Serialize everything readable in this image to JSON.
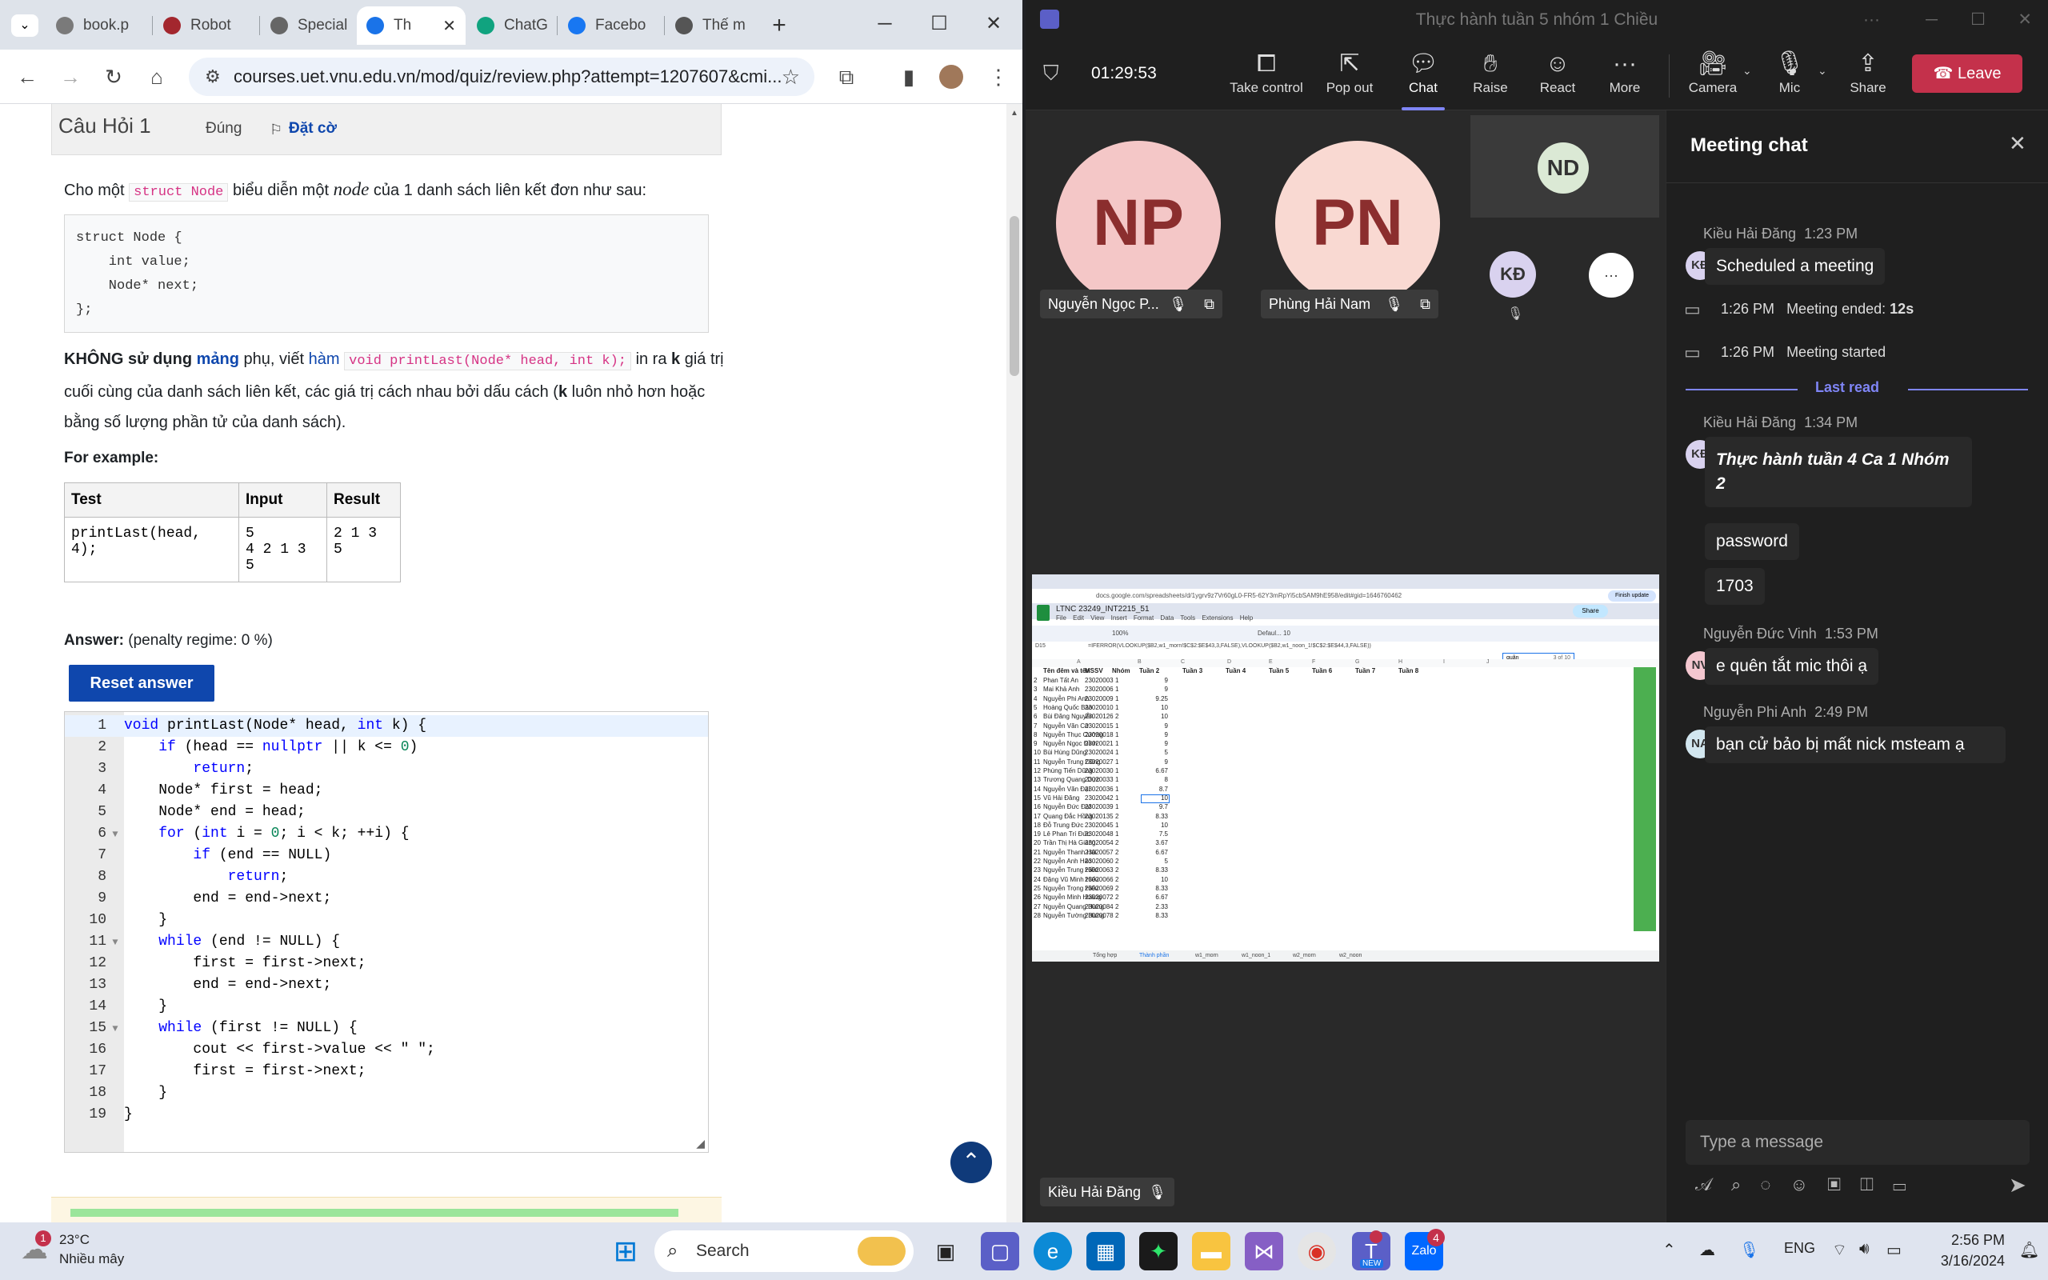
{
  "chrome": {
    "tabs": [
      {
        "label": "book.p",
        "color": "#7a7a7a"
      },
      {
        "label": "Robot",
        "color": "#a3272e"
      },
      {
        "label": "Special",
        "color": "#666"
      },
      {
        "label": "Th",
        "color": "#1a73e8"
      },
      {
        "label": "ChatG",
        "color": "#10a37f"
      },
      {
        "label": "Facebo",
        "color": "#1877f2"
      },
      {
        "label": "Thế m",
        "color": "#555"
      }
    ],
    "new_tab": "+",
    "url": "courses.uet.vnu.edu.vn/mod/quiz/review.php?attempt=1207607&cmi..."
  },
  "quiz": {
    "question_title": "Câu Hỏi 1",
    "status": "Đúng",
    "flag": "Đặt cờ",
    "intro_1": "Cho một",
    "intro_code": "struct Node",
    "intro_2": "biểu diễn một",
    "intro_node": "node",
    "intro_3": "của 1 danh sách liên kết đơn như sau:",
    "struct_code": "struct Node {\n    int value;\n    Node* next;\n};",
    "req_1": "KHÔNG sử dụng",
    "req_2": "mảng",
    "req_3": "phụ, viết",
    "req_4": "hàm",
    "req_code": "void printLast(Node* head, int k);",
    "req_5": "in ra",
    "req_6": "k",
    "req_7": "giá trị",
    "req_line2": "cuối cùng của danh sách liên kết, các giá trị cách nhau bởi dấu cách (",
    "req_k": "k",
    "req_line2b": "luôn nhỏ hơn hoặc",
    "req_line3": "bằng số lượng phần tử của danh sách).",
    "for_example": "For example:",
    "table_headers": [
      "Test",
      "Input",
      "Result"
    ],
    "table_test": "printLast(head, 4);",
    "table_input_1": "5",
    "table_input_2": "4 2 1 3 5",
    "table_result": "2 1 3 5",
    "answer_label": "Answer:",
    "penalty": "(penalty regime: 0 %)",
    "reset_button": "Reset answer"
  },
  "code_lines": [
    "void printLast(Node* head, int k) {",
    "    if (head == nullptr || k <= 0)",
    "        return;",
    "    Node* first = head;",
    "    Node* end = head;",
    "    for (int i = 0; i < k; ++i) {",
    "        if (end == NULL)",
    "            return;",
    "        end = end->next;",
    "    }",
    "    while (end != NULL) {",
    "        first = first->next;",
    "        end = end->next;",
    "    }",
    "    while (first != NULL) {",
    "        cout << first->value << \" \";",
    "        first = first->next;",
    "    }",
    "}"
  ],
  "teams": {
    "window_title": "Thực hành tuần 5 nhóm 1 Chiều",
    "timer": "01:29:53",
    "buttons": {
      "take_control": "Take control",
      "pop_out": "Pop out",
      "chat": "Chat",
      "raise": "Raise",
      "react": "React",
      "more": "More",
      "camera": "Camera",
      "mic": "Mic",
      "share": "Share",
      "leave": "Leave"
    },
    "participants": [
      {
        "initials": "NP",
        "name": "Nguyễn Ngọc P..."
      },
      {
        "initials": "PN",
        "name": "Phùng Hải Nam"
      },
      {
        "initials": "ND"
      },
      {
        "initials": "KĐ"
      }
    ],
    "more_participants": "···",
    "presenter_name": "Kiều Hải Đăng",
    "chat": {
      "title": "Meeting chat",
      "messages": [
        {
          "author": "Kiều Hải Đăng",
          "time": "1:23 PM",
          "initials": "KĐ",
          "text": "Scheduled a meeting"
        },
        {
          "time": "1:26 PM",
          "text": "Meeting ended:",
          "bold": "12s"
        },
        {
          "time": "1:26 PM",
          "text": "Meeting started"
        },
        {
          "author": "Kiều Hải Đăng",
          "time": "1:34 PM",
          "initials": "KĐ",
          "text": "Thực hành tuần 4 Ca 1 Nhóm 2"
        },
        {
          "text": "password"
        },
        {
          "text": "1703"
        },
        {
          "author": "Nguyễn Đức Vinh",
          "time": "1:53 PM",
          "initials": "NV",
          "text": "e quên tắt mic thôi ạ"
        },
        {
          "author": "Nguyễn Phi Anh",
          "time": "2:49 PM",
          "initials": "NA",
          "text": "bạn cử bảo bị mất nick msteam ạ"
        }
      ],
      "last_read": "Last read",
      "input_placeholder": "Type a message"
    }
  },
  "spreadsheet": {
    "url": "docs.google.com/spreadsheets/d/1ygrv9z7Vr60gL0-FR5-62Y3mRpYi5cbSAM9hE958/edit#gid=1646760462",
    "title": "LTNC 23249_INT2215_51",
    "menu": [
      "File",
      "Edit",
      "View",
      "Insert",
      "Format",
      "Data",
      "Tools",
      "Extensions",
      "Help"
    ],
    "share": "Share",
    "finish_update": "Finish update",
    "zoom": "100%",
    "font_size": "10",
    "font": "Defaul...",
    "cell_ref": "D15",
    "formula": "=IFERROR(VLOOKUP($B2,w1_morn!$C$2:$E$43,3,FALSE),VLOOKUP($B2,w1_noon_1!$C$2:$E$44,3,FALSE))",
    "search_text": "quân",
    "search_count": "3 of 10",
    "col_headers": [
      "A",
      "B",
      "C",
      "D",
      "E",
      "F",
      "G",
      "H",
      "I",
      "J"
    ],
    "headers": [
      "Tên đêm và tên",
      "MSSV",
      "Nhóm",
      "Tuần 2",
      "Tuần 3",
      "Tuần 4",
      "Tuần 5",
      "Tuần 6",
      "Tuần 7",
      "Tuần 8"
    ],
    "rows": [
      [
        "Phan Tất An",
        "23020003",
        "1",
        "9"
      ],
      [
        "Mai Khả Anh",
        "23020006",
        "1",
        "9"
      ],
      [
        "Nguyễn Phi Anh",
        "23020009",
        "1",
        "9.25"
      ],
      [
        "Hoàng Quốc Bảo",
        "23020010",
        "1",
        "10"
      ],
      [
        "Bùi Đăng Nguyễn",
        "23020126",
        "2",
        "10"
      ],
      [
        "Nguyễn Văn Cơ",
        "23020015",
        "1",
        "9"
      ],
      [
        "Nguyễn Thục Cường",
        "23020018",
        "1",
        "9"
      ],
      [
        "Nguyễn Ngọc Đỉnh",
        "23020021",
        "1",
        "9"
      ],
      [
        "Bùi Hùng Dũng",
        "23020024",
        "1",
        "5"
      ],
      [
        "Nguyễn Trung Dũng",
        "23020027",
        "1",
        "9"
      ],
      [
        "Phùng Tiến Dũng",
        "23020030",
        "1",
        "6.67"
      ],
      [
        "Trương Quang Dực",
        "23020033",
        "1",
        "8"
      ],
      [
        "Nguyễn Văn Đại",
        "23020036",
        "1",
        "8.7"
      ],
      [
        "Vũ Hải Đăng",
        "23020042",
        "1",
        "10"
      ],
      [
        "Nguyễn Đức Đạt",
        "23020039",
        "1",
        "9.7"
      ],
      [
        "Quang Đắc Hồng",
        "23020135",
        "2",
        "8.33"
      ],
      [
        "Đỗ Trung Đức",
        "23020045",
        "1",
        "10"
      ],
      [
        "Lê Phan Trí Đức",
        "23020048",
        "1",
        "7.5"
      ],
      [
        "Trần Thị Hà Giang",
        "23020054",
        "2",
        "3.67"
      ],
      [
        "Nguyễn Thanh Hải",
        "23020057",
        "2",
        "6.67"
      ],
      [
        "Nguyễn Anh Hào",
        "23020060",
        "2",
        "5"
      ],
      [
        "Nguyễn Trung Hiền",
        "23020063",
        "2",
        "8.33"
      ],
      [
        "Đặng Vũ Minh Hiếu",
        "23020066",
        "2",
        "10"
      ],
      [
        "Nguyễn Trọng Hiếu",
        "23020069",
        "2",
        "8.33"
      ],
      [
        "Nguyễn Minh Hoàng",
        "23020072",
        "2",
        "6.67"
      ],
      [
        "Nguyễn Quang Hưng",
        "23020084",
        "2",
        "2.33"
      ],
      [
        "Nguyễn Tường Hưng",
        "23020078",
        "2",
        "8.33"
      ]
    ],
    "sheet_tabs": [
      "Tổng hợp",
      "Thành phần",
      "w1_morn",
      "w1_noon_1",
      "w2_morn",
      "w2_noon"
    ]
  },
  "taskbar": {
    "weather_temp": "23°C",
    "weather_desc": "Nhiều mây",
    "weather_badge": "1",
    "search": "Search",
    "lang": "ENG",
    "time": "2:56 PM",
    "date": "3/16/2024",
    "zalo_badge": "4",
    "teams_badge": "NEW"
  },
  "colors": {
    "teams_accent": "#7f85f5",
    "leave_red": "#c4314b",
    "moodle_blue": "#0f47ad"
  }
}
